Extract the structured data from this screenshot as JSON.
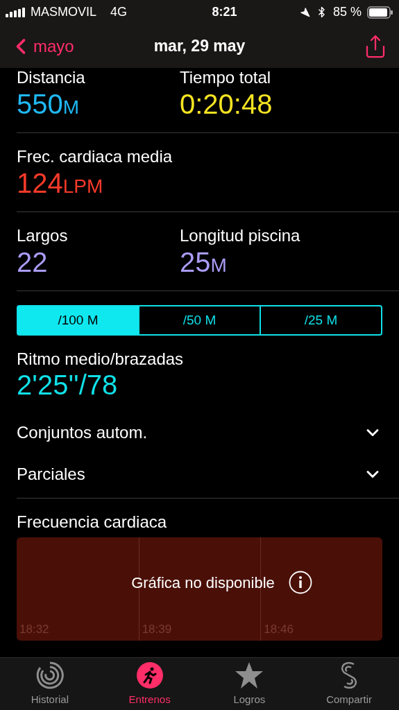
{
  "status_bar": {
    "carrier": "MASMOVIL",
    "network": "4G",
    "time": "8:21",
    "battery": "85 %"
  },
  "nav": {
    "back": "mayo",
    "title": "mar, 29 may"
  },
  "metric_rows": [
    {
      "metrics": [
        {
          "label": "Distancia",
          "value": "550",
          "unit": "M",
          "color": "#1fb8f5"
        },
        {
          "label": "Tiempo total",
          "value": "0:20:48",
          "color": "#f5e322"
        }
      ]
    },
    {
      "metrics": [
        {
          "label": "Frec. cardiaca media",
          "value": "124",
          "unit": "LPM",
          "color": "#fa3a2a"
        }
      ]
    },
    {
      "metrics": [
        {
          "label": "Largos",
          "value": "22",
          "color": "#a99cf5"
        },
        {
          "label": "Longitud piscina",
          "value": "25",
          "unit": "M",
          "color": "#a99cf5"
        }
      ]
    }
  ],
  "segments": [
    {
      "label": "/100 M",
      "selected": true
    },
    {
      "label": "/50 M",
      "selected": false
    },
    {
      "label": "/25 M",
      "selected": false
    }
  ],
  "pace": {
    "label": "Ritmo medio/brazadas",
    "value": "2'25''/78"
  },
  "sections": [
    {
      "label": "Conjuntos autom.",
      "expanded": false
    },
    {
      "label": "Parciales",
      "expanded": false
    }
  ],
  "heart_chart": {
    "title": "Frecuencia cardiaca",
    "message": "Gráfica no disponible",
    "times": [
      "18:32",
      "18:39",
      "18:46"
    ]
  },
  "tab_bar": [
    {
      "label": "Historial",
      "selected": false
    },
    {
      "label": "Entrenos",
      "selected": true
    },
    {
      "label": "Logros",
      "selected": false
    },
    {
      "label": "Compartir",
      "selected": false
    }
  ]
}
